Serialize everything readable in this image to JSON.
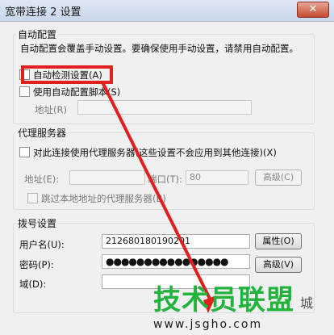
{
  "window": {
    "title": "宽带连接 2 设置",
    "close_label": "✕"
  },
  "auto_config": {
    "legend": "自动配置",
    "description": "自动配置会覆盖手动设置。要确保使用手动设置，请禁用自动配置。",
    "auto_detect_label": "自动检测设置(A)",
    "script_label": "使用自动配置脚本(S)",
    "address_label": "地址(R)",
    "address_value": ""
  },
  "proxy": {
    "legend": "代理服务器",
    "use_proxy_label": "对此连接使用代理服务器(这些设置不会应用到其他连接)(X)",
    "address_label": "地址(E):",
    "address_value": "",
    "port_label": "端口(T):",
    "port_value": "80",
    "advanced_label": "高级(C)",
    "bypass_label": "跳过本地地址的代理服务器(B)"
  },
  "dialup": {
    "legend": "拨号设置",
    "username_label": "用户名(U):",
    "username_value": "2126801801902​01",
    "properties_label": "属性(O)",
    "password_label": "密码(P):",
    "password_value": "●●●●●●●●●●●●●●●●",
    "advanced_label": "高级(V)",
    "domain_label": "域(D):",
    "domain_value": ""
  },
  "watermark": {
    "brand": "技术员联盟",
    "side_text": "城",
    "url": "www.jsgho.com"
  },
  "colors": {
    "annotation_red": "#e01f1f",
    "watermark_green": "#22b33c"
  }
}
